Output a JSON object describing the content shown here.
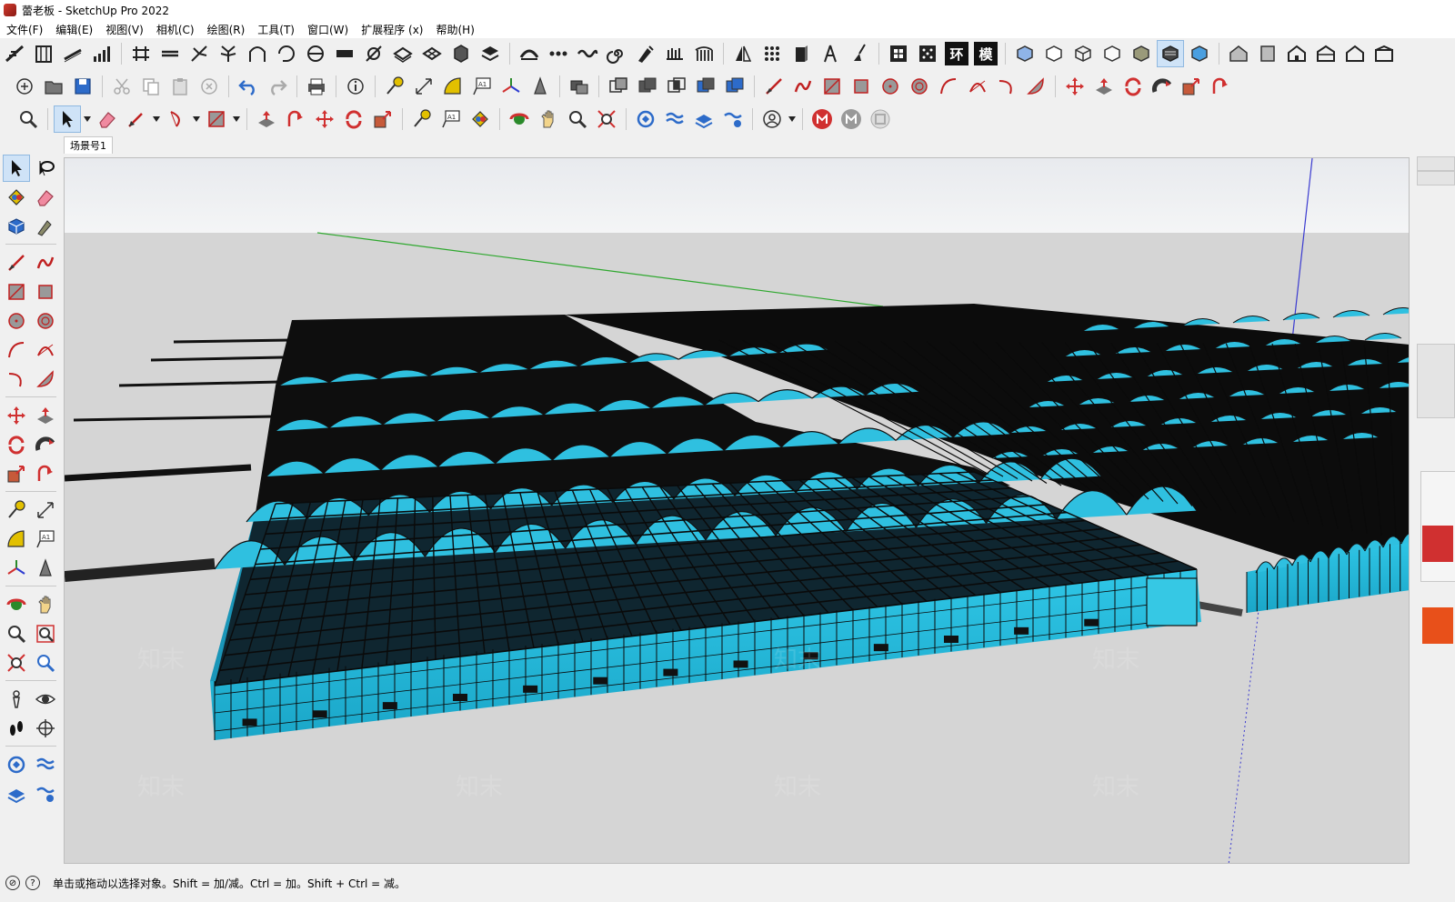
{
  "window": {
    "title": "蕾老板 - SketchUp Pro 2022"
  },
  "menu": [
    "文件(F)",
    "编辑(E)",
    "视图(V)",
    "相机(C)",
    "绘图(R)",
    "工具(T)",
    "窗口(W)",
    "扩展程序 (x)",
    "帮助(H)"
  ],
  "scene_tab": {
    "label": "场景号1"
  },
  "toolbar_text": {
    "ring": "环",
    "model": "模",
    "label_tool": "A1"
  },
  "status": {
    "text": "单击或拖动以选择对象。Shift = 加/减。Ctrl = 加。Shift + Ctrl = 减。"
  },
  "watermark": {
    "text": "知末"
  },
  "colors": {
    "sky_top": "#e6e8ec",
    "ground": "#d5d5d5",
    "glass": "#2bb8d8",
    "frame": "#101010",
    "axis_green": "#2fa82f",
    "axis_blue": "#3b3bd0",
    "accent_red": "#d03030"
  }
}
